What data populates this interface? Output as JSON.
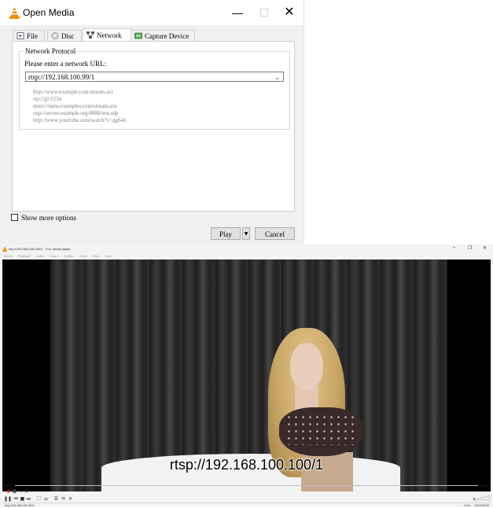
{
  "dialog": {
    "title": "Open Media",
    "window_buttons": {
      "minimize": "—",
      "maximize": "☐",
      "close": "✕"
    },
    "tabs": [
      {
        "label": "File",
        "icon": "file-icon"
      },
      {
        "label": "Disc",
        "icon": "disc-icon"
      },
      {
        "label": "Network",
        "icon": "network-icon",
        "active": true
      },
      {
        "label": "Capture Device",
        "icon": "capture-device-icon"
      }
    ],
    "group_title": "Network Protocol",
    "url_prompt": "Please enter a network URL:",
    "url_value": "rtsp://192.168.100.99/1",
    "examples": [
      "http://www.example.com/stream.avi",
      "rtp://@:1234",
      "mms://mms.examples.com/stream.asx",
      "rtsp://server.example.org:8080/test.sdp",
      "http://www.yourtube.com/watch?v=gg64x"
    ],
    "show_more_options": "Show more options",
    "play_label": "Play",
    "cancel_label": "Cancel"
  },
  "player": {
    "title": "rtsp://192.168.100.100/1 - VLC media player",
    "menu": [
      "Media",
      "Playback",
      "Audio",
      "Video",
      "Subtitle",
      "Tools",
      "View",
      "Help"
    ],
    "window_buttons": {
      "minimize": "–",
      "restore": "❐",
      "close": "✕"
    },
    "overlay_text": "rtsp://192.168.100.100/1",
    "time_elapsed": "00:00",
    "time_total": "00:00",
    "status_url": "rtsp://192.168.100.100/1",
    "speed": "1.00x",
    "status_time": "00:00/00:00"
  },
  "colors": {
    "accent_cone": "#f28b00",
    "video_bg": "#000000"
  }
}
